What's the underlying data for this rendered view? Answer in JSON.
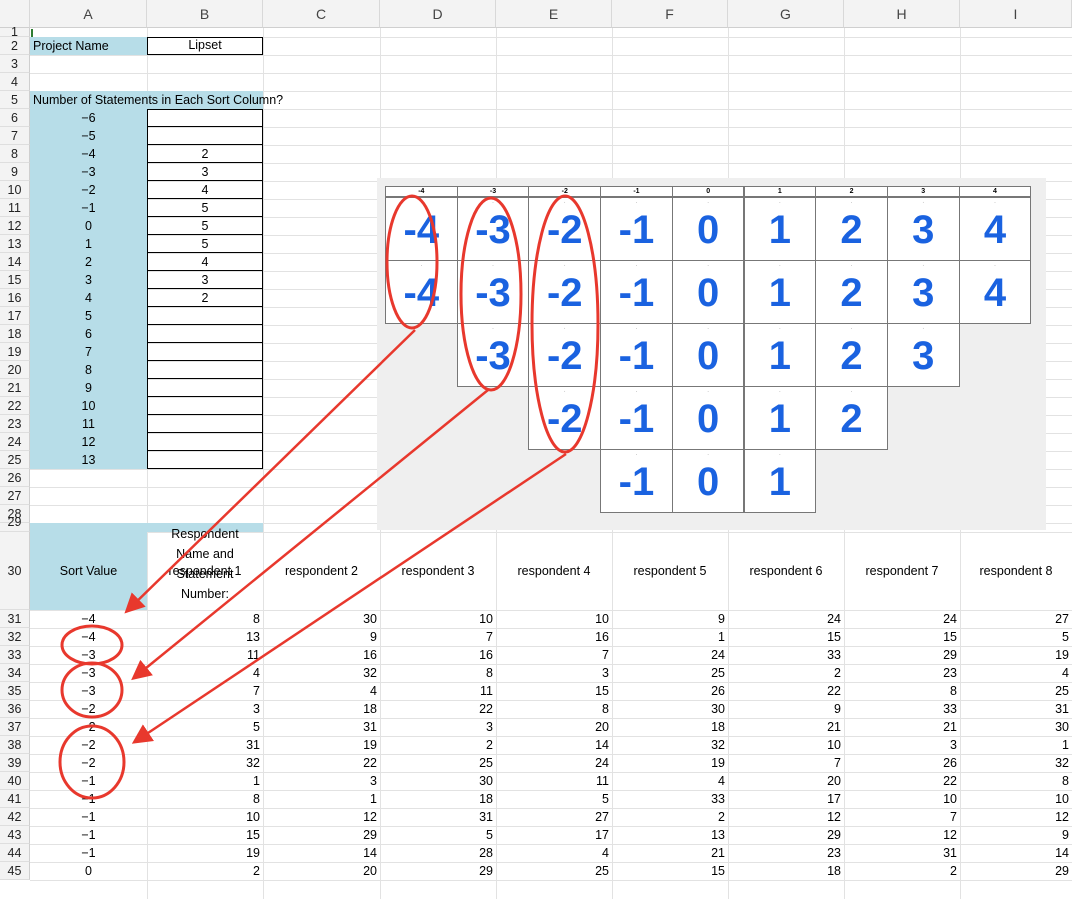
{
  "columns": [
    "A",
    "B",
    "C",
    "D",
    "E",
    "F",
    "G",
    "H",
    "I"
  ],
  "rows": [
    "1",
    "2",
    "3",
    "4",
    "5",
    "6",
    "7",
    "8",
    "9",
    "10",
    "11",
    "12",
    "13",
    "14",
    "15",
    "16",
    "17",
    "18",
    "19",
    "20",
    "21",
    "22",
    "23",
    "24",
    "25",
    "26",
    "27",
    "28",
    "29",
    "30",
    "31",
    "32",
    "33",
    "34",
    "35",
    "36",
    "37",
    "38",
    "39",
    "40",
    "41",
    "42",
    "43",
    "44",
    "45"
  ],
  "project": {
    "label": "Project Name",
    "value": "Lipset"
  },
  "statements_title": "Number of Statements in Each Sort Column?",
  "sort_columns": [
    "−6",
    "−5",
    "−4",
    "−3",
    "−2",
    "−1",
    "0",
    "1",
    "2",
    "3",
    "4",
    "5",
    "6",
    "7",
    "8",
    "9",
    "10",
    "11",
    "12",
    "13"
  ],
  "sort_counts": [
    "",
    "",
    "2",
    "3",
    "4",
    "5",
    "5",
    "5",
    "4",
    "3",
    "2",
    "",
    "",
    "",
    "",
    "",
    "",
    "",
    "",
    ""
  ],
  "qsort": {
    "headers": [
      "-4",
      "-3",
      "-2",
      "-1",
      "0",
      "1",
      "2",
      "3",
      "4"
    ],
    "columns": [
      [
        "-4",
        "-4"
      ],
      [
        "-3",
        "-3",
        "-3"
      ],
      [
        "-2",
        "-2",
        "-2",
        "-2"
      ],
      [
        "-1",
        "-1",
        "-1",
        "-1",
        "-1"
      ],
      [
        "0",
        "0",
        "0",
        "0",
        "0"
      ],
      [
        "1",
        "1",
        "1",
        "1",
        "1"
      ],
      [
        "2",
        "2",
        "2",
        "2"
      ],
      [
        "3",
        "3",
        "3"
      ],
      [
        "4",
        "4"
      ]
    ]
  },
  "resp_header": {
    "line1": "Respondent",
    "line2": "Name and",
    "line3": "Statement",
    "line4": "Number:"
  },
  "sort_value_label": "Sort Value",
  "respondents": [
    "respondent 1",
    "respondent 2",
    "respondent 3",
    "respondent 4",
    "respondent 5",
    "respondent 6",
    "respondent 7",
    "respondent 8"
  ],
  "data_rows": [
    {
      "sv": "−4",
      "v": [
        "8",
        "30",
        "10",
        "10",
        "9",
        "24",
        "24",
        "27"
      ]
    },
    {
      "sv": "−4",
      "v": [
        "13",
        "9",
        "7",
        "16",
        "1",
        "15",
        "15",
        "5"
      ]
    },
    {
      "sv": "−3",
      "v": [
        "11",
        "16",
        "16",
        "7",
        "24",
        "33",
        "29",
        "19"
      ]
    },
    {
      "sv": "−3",
      "v": [
        "4",
        "32",
        "8",
        "3",
        "25",
        "2",
        "23",
        "4"
      ]
    },
    {
      "sv": "−3",
      "v": [
        "7",
        "4",
        "11",
        "15",
        "26",
        "22",
        "8",
        "25"
      ]
    },
    {
      "sv": "−2",
      "v": [
        "3",
        "18",
        "22",
        "8",
        "30",
        "9",
        "33",
        "31"
      ]
    },
    {
      "sv": "−2",
      "v": [
        "5",
        "31",
        "3",
        "20",
        "18",
        "21",
        "21",
        "30"
      ]
    },
    {
      "sv": "−2",
      "v": [
        "31",
        "19",
        "2",
        "14",
        "32",
        "10",
        "3",
        "1"
      ]
    },
    {
      "sv": "−2",
      "v": [
        "32",
        "22",
        "25",
        "24",
        "19",
        "7",
        "26",
        "32"
      ]
    },
    {
      "sv": "−1",
      "v": [
        "1",
        "3",
        "30",
        "11",
        "4",
        "20",
        "22",
        "8"
      ]
    },
    {
      "sv": "−1",
      "v": [
        "8",
        "1",
        "18",
        "5",
        "33",
        "17",
        "10",
        "10"
      ]
    },
    {
      "sv": "−1",
      "v": [
        "10",
        "12",
        "31",
        "27",
        "2",
        "12",
        "7",
        "12"
      ]
    },
    {
      "sv": "−1",
      "v": [
        "15",
        "29",
        "5",
        "17",
        "13",
        "29",
        "12",
        "9"
      ]
    },
    {
      "sv": "−1",
      "v": [
        "19",
        "14",
        "28",
        "4",
        "21",
        "23",
        "31",
        "14"
      ]
    },
    {
      "sv": "0",
      "v": [
        "2",
        "20",
        "29",
        "25",
        "15",
        "18",
        "2",
        "29"
      ]
    }
  ],
  "colors": {
    "cell_blue": "#b7dde8",
    "qsort_blue": "#1a62e0",
    "annotation_red": "#e8382d"
  }
}
